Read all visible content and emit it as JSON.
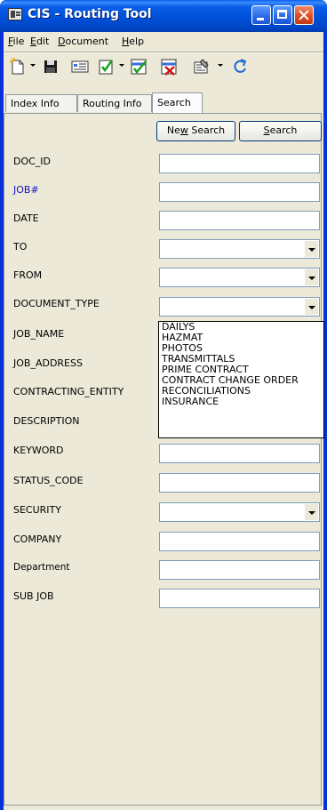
{
  "window": {
    "title": "CIS - Routing Tool"
  },
  "menu": [
    {
      "key": "F",
      "rest": "ile"
    },
    {
      "key": "E",
      "rest": "dit"
    },
    {
      "key": "D",
      "rest": "ocument"
    },
    {
      "key": "H",
      "rest": "elp"
    }
  ],
  "toolbar": {
    "icons": [
      "new-document-icon",
      "save-icon",
      "properties-card-icon",
      "checklist-icon",
      "route-approve-icon",
      "route-reject-icon",
      "document-properties-icon",
      "refresh-icon"
    ]
  },
  "tabs": [
    "Index Info",
    "Routing Info",
    "Search"
  ],
  "active_tab": "Search",
  "buttons": {
    "new_search_pre": "Ne",
    "new_search_key": "w",
    "new_search_post": " Search",
    "search_key": "S",
    "search_post": "earch"
  },
  "fields": [
    {
      "label": "DOC_ID",
      "type": "text",
      "value": ""
    },
    {
      "label": "JOB#",
      "type": "text",
      "value": ""
    },
    {
      "label": "DATE",
      "type": "text",
      "value": ""
    },
    {
      "label": "TO",
      "type": "combo",
      "value": ""
    },
    {
      "label": "FROM",
      "type": "combo",
      "value": ""
    },
    {
      "label": "DOCUMENT_TYPE",
      "type": "combo",
      "value": ""
    },
    {
      "label": "JOB_NAME",
      "type": "text",
      "value": ""
    },
    {
      "label": "JOB_ADDRESS",
      "type": "text",
      "value": ""
    },
    {
      "label": "CONTRACTING_ENTITY",
      "type": "text",
      "value": ""
    },
    {
      "label": "DESCRIPTION",
      "type": "text",
      "value": ""
    },
    {
      "label": "KEYWORD",
      "type": "text",
      "value": ""
    },
    {
      "label": "STATUS_CODE",
      "type": "text",
      "value": ""
    },
    {
      "label": "SECURITY",
      "type": "combo",
      "value": ""
    },
    {
      "label": "COMPANY",
      "type": "text",
      "value": ""
    },
    {
      "label": "Department",
      "type": "text",
      "value": ""
    },
    {
      "label": "SUB JOB",
      "type": "text",
      "value": ""
    }
  ],
  "document_type_options": [
    "DAILYS",
    "HAZMAT",
    "PHOTOS",
    "TRANSMITTALS",
    "PRIME CONTRACT",
    "CONTRACT CHANGE ORDER",
    "RECONCILIATIONS",
    "INSURANCE"
  ],
  "colors": {
    "titlebar": "#0054e3",
    "face": "#ece9d8",
    "field_border": "#7f9db9",
    "job_label": "#1515c8"
  }
}
